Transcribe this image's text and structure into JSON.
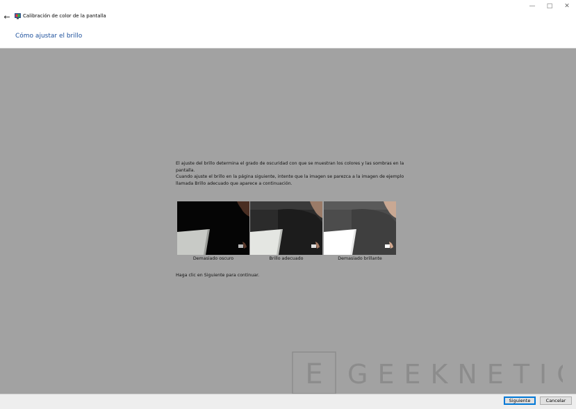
{
  "window": {
    "title": "Calibración de color de la pantalla",
    "controls": {
      "minimize": "—",
      "maximize": "□",
      "close": "✕"
    }
  },
  "header": {
    "page_title": "Cómo ajustar el brillo"
  },
  "main": {
    "paragraph1": "El ajuste del brillo determina el grado de oscuridad con que se muestran los colores y las sombras en la pantalla.",
    "paragraph2": "Cuando ajuste el brillo en la página siguiente, intente que la imagen se parezca a la imagen de ejemplo llamada Brillo adecuado que aparece a continuación.",
    "samples": [
      {
        "caption": "Demasiado oscuro"
      },
      {
        "caption": "Brillo adecuado"
      },
      {
        "caption": "Demasiado brillante"
      }
    ],
    "instruction": "Haga clic en Siguiente para continuar."
  },
  "watermark": {
    "text": "GEEKNETIC",
    "logo_letter": "E"
  },
  "footer": {
    "next_label": "Siguiente",
    "cancel_label": "Cancelar"
  },
  "icons": {
    "back": "back-arrow-icon",
    "app": "display-calibration-icon"
  },
  "colors": {
    "accent": "#1b4f9c",
    "content_bg": "#a2a2a2",
    "button_focus": "#0078d7"
  }
}
